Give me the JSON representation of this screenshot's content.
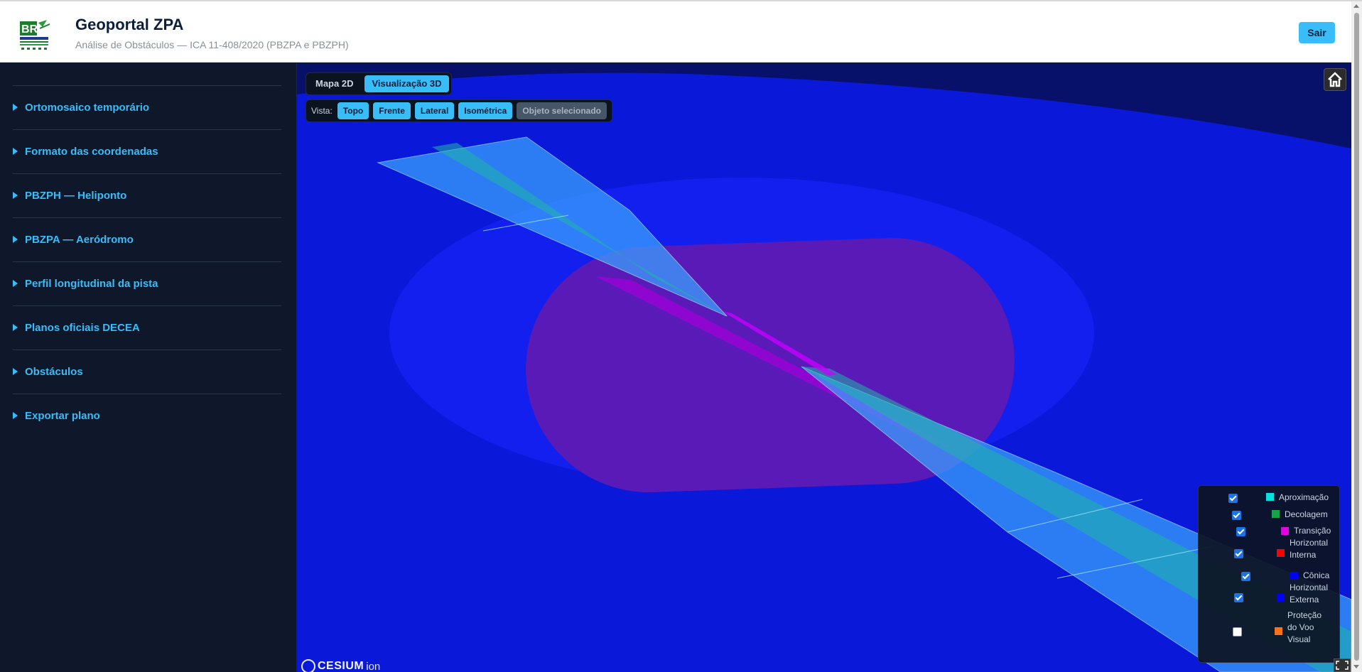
{
  "header": {
    "title": "Geoportal ZPA",
    "subtitle": "Análise de Obstáculos — ICA 11-408/2020 (PBZPA e PBZPH)",
    "logout_label": "Sair",
    "logo_icon": "br-consultoria-logo"
  },
  "sidebar": {
    "items": [
      {
        "label": "Ortomosaico temporário"
      },
      {
        "label": "Formato das coordenadas"
      },
      {
        "label": "PBZPH — Heliponto"
      },
      {
        "label": "PBZPA — Aeródromo"
      },
      {
        "label": "Perfil longitudinal da pista"
      },
      {
        "label": "Planos oficiais DECEA"
      },
      {
        "label": "Obstáculos"
      },
      {
        "label": "Exportar plano"
      }
    ]
  },
  "map": {
    "tabs": [
      {
        "label": "Mapa 2D",
        "active": false
      },
      {
        "label": "Visualização 3D",
        "active": true
      }
    ],
    "view_label": "Vista:",
    "view_buttons": [
      {
        "label": "Topo",
        "enabled": true
      },
      {
        "label": "Frente",
        "enabled": true
      },
      {
        "label": "Lateral",
        "enabled": true
      },
      {
        "label": "Isométrica",
        "enabled": true
      },
      {
        "label": "Objeto selecionado",
        "enabled": false
      }
    ],
    "home_icon": "home-icon",
    "attribution": {
      "brand": "CESIUM",
      "suffix": "ion"
    }
  },
  "legend": {
    "items": [
      {
        "label": "Aproximação",
        "checked": true,
        "color": "#06e0e0"
      },
      {
        "label": "Decolagem",
        "checked": true,
        "color": "#16a34a"
      },
      {
        "label": "Transição",
        "checked": true,
        "color": "#e600e6"
      },
      {
        "label": "Horizontal Interna",
        "checked": true,
        "color": "#ff0000"
      },
      {
        "label": "Cônica",
        "checked": true,
        "color": "#0000ff"
      },
      {
        "label": "Horizontal Externa",
        "checked": true,
        "color": "#0000ff"
      },
      {
        "label": "Proteção do Voo Visual",
        "checked": false,
        "color": "#f97316"
      }
    ]
  },
  "colors": {
    "accent": "#38bdf8",
    "sidebar_bg": "#0f172a",
    "scene_bg": "#081169"
  }
}
